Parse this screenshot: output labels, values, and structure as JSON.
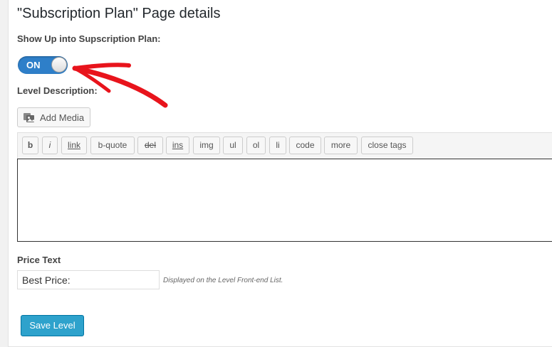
{
  "page": {
    "title": "\"Subscription Plan\" Page details"
  },
  "show_up": {
    "label": "Show Up into Supscription Plan:",
    "toggle_state": "ON"
  },
  "level_description": {
    "label": "Level Description:",
    "add_media_label": "Add Media",
    "quicktags": [
      "b",
      "i",
      "link",
      "b-quote",
      "del",
      "ins",
      "img",
      "ul",
      "ol",
      "li",
      "code",
      "more",
      "close tags"
    ],
    "editor_value": ""
  },
  "price": {
    "label": "Price Text",
    "value": "Best Price:",
    "hint": "Displayed on the Level Front-end List."
  },
  "actions": {
    "save_label": "Save Level"
  },
  "colors": {
    "toggle_on": "#2e7fc9",
    "save_button": "#2ea2cc",
    "annotation_arrow": "#e8141c"
  },
  "icons": {
    "add_media": "media-icon",
    "annotation": "red-arrow-icon"
  }
}
